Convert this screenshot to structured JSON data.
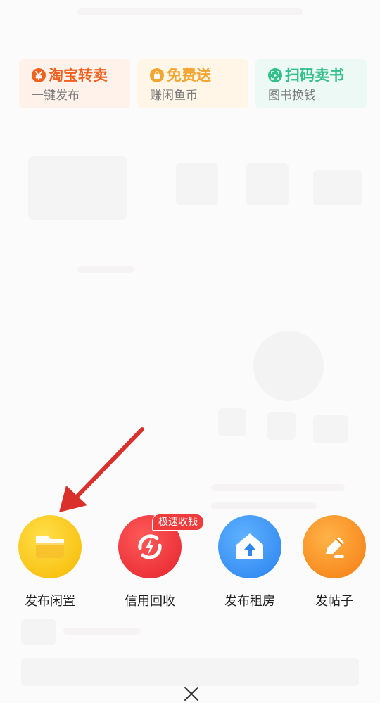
{
  "shortcuts": [
    {
      "title": "淘宝转卖",
      "subtitle": "一键发布",
      "icon": "yen-icon",
      "color": "#f0601f"
    },
    {
      "title": "免费送",
      "subtitle": "赚闲鱼币",
      "icon": "gift-bag-icon",
      "color": "#f2a531"
    },
    {
      "title": "扫码卖书",
      "subtitle": "图书换钱",
      "icon": "scan-icon",
      "color": "#34c08a"
    }
  ],
  "actions": [
    {
      "label": "发布闲置",
      "icon": "folder-icon",
      "color": "#f9c51a"
    },
    {
      "label": "信用回收",
      "icon": "recycle-bolt-icon",
      "color": "#e8262f",
      "badge": "极速收钱"
    },
    {
      "label": "发布租房",
      "icon": "house-upload-icon",
      "color": "#3d8ff3"
    },
    {
      "label": "发帖子",
      "icon": "pencil-icon",
      "color": "#f78a1e"
    }
  ],
  "annotation": {
    "color": "#d9302b"
  }
}
